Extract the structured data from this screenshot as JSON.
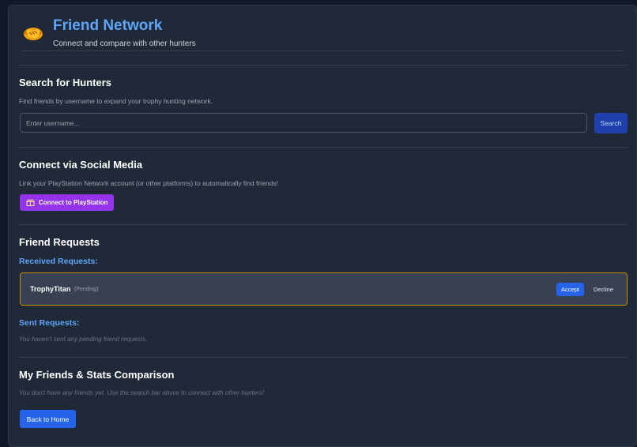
{
  "header": {
    "icon": "handshake-icon",
    "title": "Friend Network",
    "subtitle": "Connect and compare with other hunters"
  },
  "search": {
    "heading": "Search for Hunters",
    "description": "Find friends by username to expand your trophy hunting network.",
    "placeholder": "Enter username...",
    "button_label": "Search"
  },
  "social": {
    "heading": "Connect via Social Media",
    "description": "Link your PlayStation Network account (or other platforms) to automatically find friends!",
    "button_icon": "gift-icon",
    "button_label": "Connect to PlayStation"
  },
  "requests": {
    "heading": "Friend Requests",
    "received_heading": "Received Requests:",
    "received": [
      {
        "name": "TrophyTitan",
        "status": "(Pending)",
        "accept_label": "Accept",
        "decline_label": "Decline"
      }
    ],
    "sent_heading": "Sent Requests:",
    "sent_empty": "You haven't sent any pending friend requests."
  },
  "friends": {
    "heading": "My Friends & Stats Comparison",
    "empty": "You don't have any friends yet. Use the search bar above to connect with other hunters!"
  },
  "footer": {
    "back_label": "Back to Home"
  },
  "colors": {
    "accent_blue": "#60a5fa",
    "button_blue": "#2563eb",
    "playstation_purple": "#9333ea",
    "pending_border": "#ca8a04"
  }
}
